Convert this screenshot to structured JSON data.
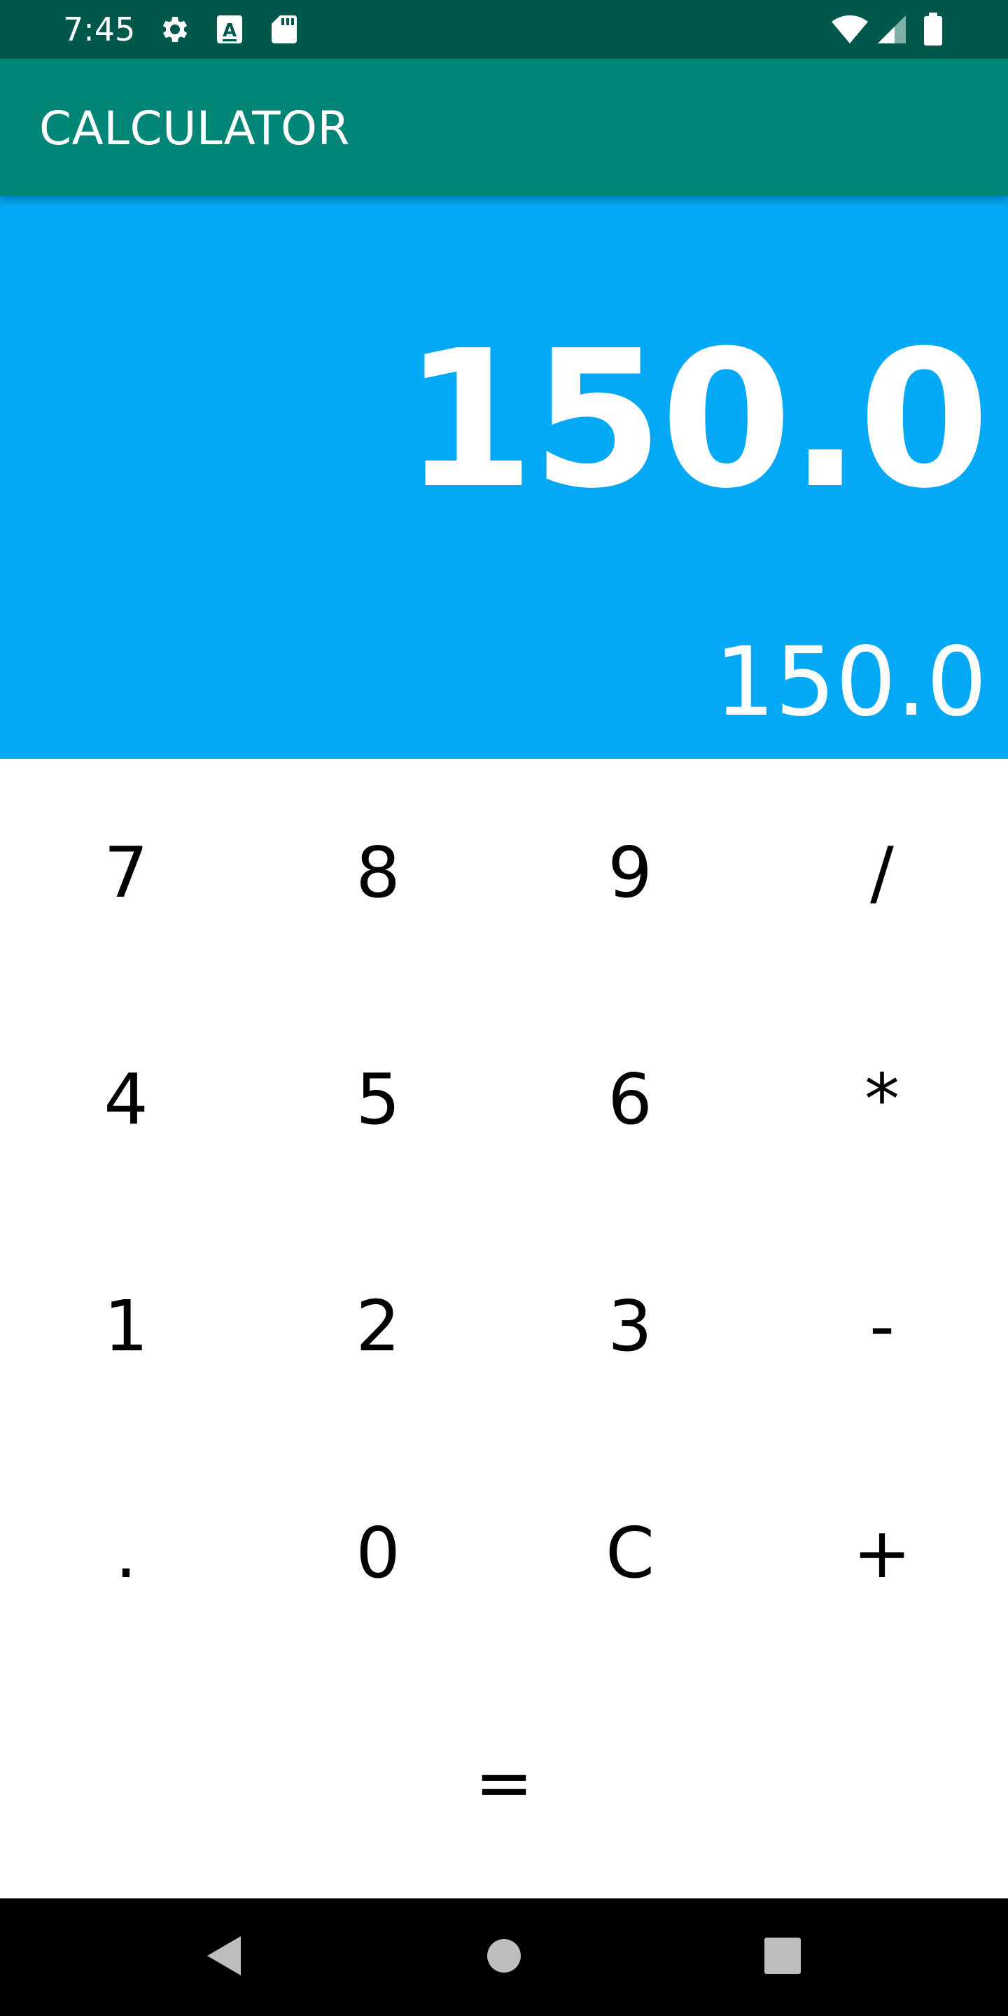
{
  "status_bar": {
    "time": "7:45",
    "icons": [
      "gear-icon",
      "text-a-icon",
      "sd-card-icon",
      "wifi-icon",
      "signal-icon",
      "battery-icon"
    ]
  },
  "app_bar": {
    "title": "CALCULATOR",
    "color": "#008577"
  },
  "display": {
    "main_value": "150.0",
    "secondary_value": "150.0",
    "color": "#03a9f4"
  },
  "keypad": {
    "rows": [
      [
        "7",
        "8",
        "9",
        "/"
      ],
      [
        "4",
        "5",
        "6",
        "*"
      ],
      [
        "1",
        "2",
        "3",
        "-"
      ],
      [
        ".",
        "0",
        "C",
        "+"
      ]
    ],
    "equals": "="
  },
  "nav_bar": {
    "buttons": [
      "back-icon",
      "home-icon",
      "recents-icon"
    ]
  },
  "colors": {
    "status_bar": "#00574b",
    "key_text": "#000000"
  }
}
